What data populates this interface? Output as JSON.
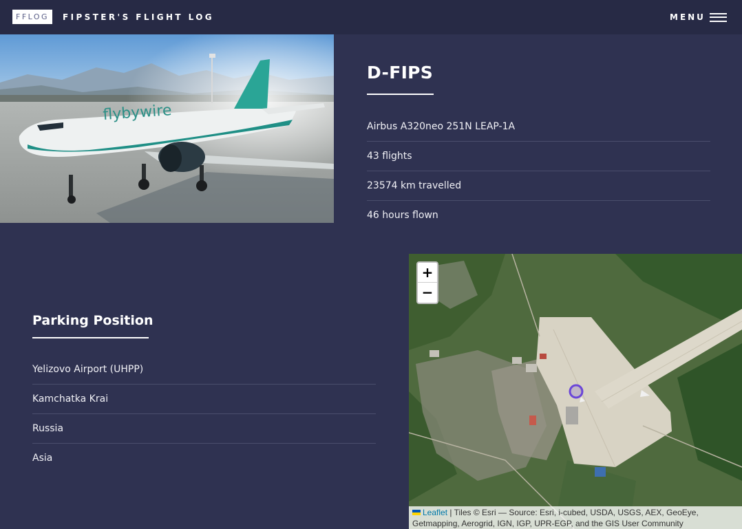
{
  "header": {
    "logo": "FFLOG",
    "title": "FIPSTER'S FLIGHT LOG",
    "menu_label": "MENU"
  },
  "aircraft": {
    "registration": "D-FIPS",
    "photo_label": "flybywire",
    "info": [
      "Airbus A320neo 251N LEAP-1A",
      "43 flights",
      "23574 km travelled",
      "46 hours flown"
    ]
  },
  "parking": {
    "title": "Parking Position",
    "items": [
      "Yelizovo Airport (UHPP)",
      "Kamchatka Krai",
      "Russia",
      "Asia"
    ]
  },
  "map": {
    "zoom_in": "+",
    "zoom_out": "−",
    "leaflet_label": "Leaflet",
    "attribution_text": " | Tiles © Esri — Source: Esri, i-cubed, USDA, USGS, AEX, GeoEye, Getmapping, Aerogrid, IGN, IGP, UPR-EGP, and the GIS User Community"
  },
  "colors": {
    "background": "#2f3251",
    "header": "#272a45",
    "marker": "#6a45d8",
    "leaflet_link": "#0078a8"
  }
}
